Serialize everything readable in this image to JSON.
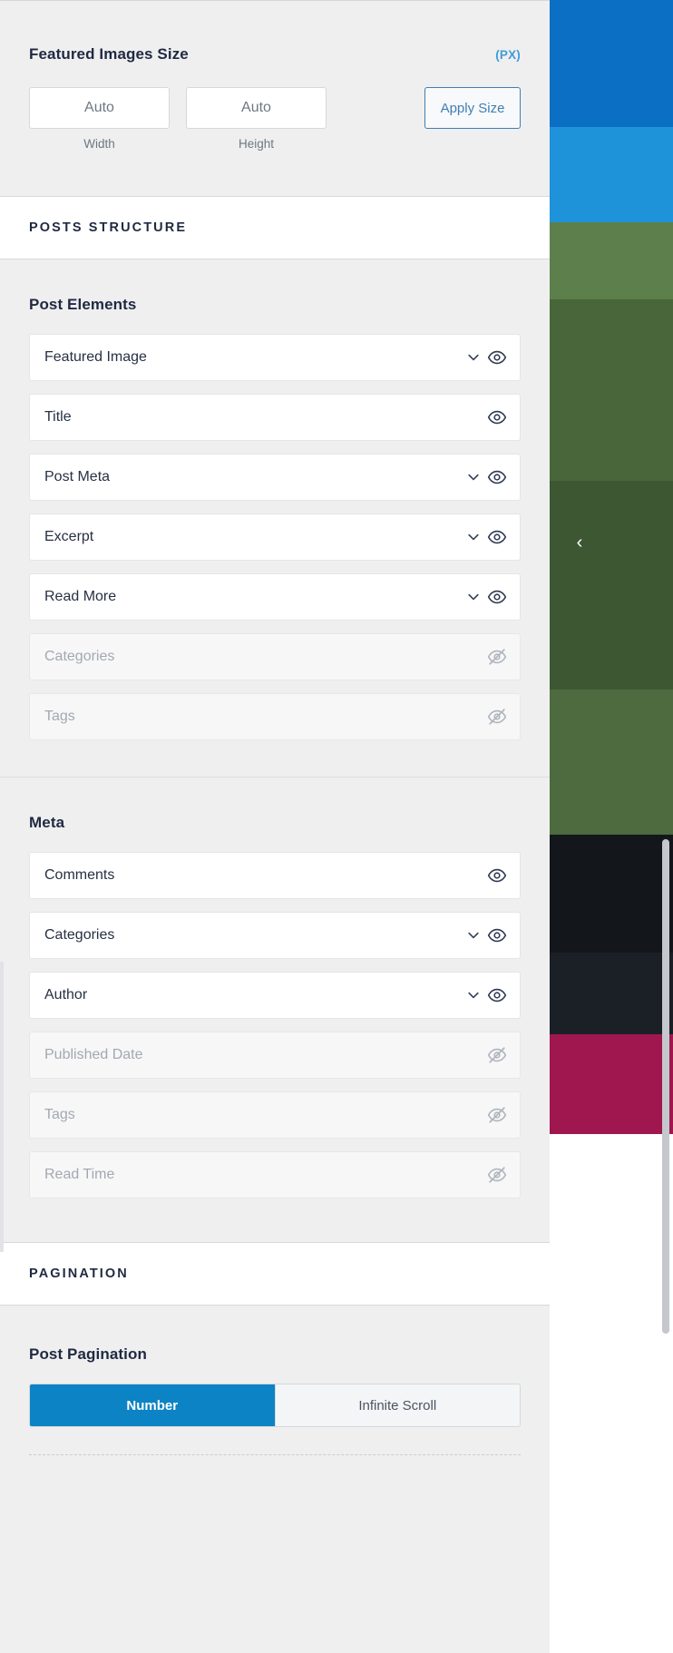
{
  "featured_images_size": {
    "title": "Featured Images Size",
    "unit_label": "(PX)",
    "width": {
      "value": "Auto",
      "caption": "Width"
    },
    "height": {
      "value": "Auto",
      "caption": "Height"
    },
    "apply_label": "Apply Size"
  },
  "posts_structure": {
    "section_label": "POSTS STRUCTURE",
    "post_elements": {
      "title": "Post Elements",
      "items": [
        {
          "label": "Featured Image",
          "enabled": true,
          "has_chevron": true
        },
        {
          "label": "Title",
          "enabled": true,
          "has_chevron": false
        },
        {
          "label": "Post Meta",
          "enabled": true,
          "has_chevron": true
        },
        {
          "label": "Excerpt",
          "enabled": true,
          "has_chevron": true
        },
        {
          "label": "Read More",
          "enabled": true,
          "has_chevron": true
        },
        {
          "label": "Categories",
          "enabled": false,
          "has_chevron": false
        },
        {
          "label": "Tags",
          "enabled": false,
          "has_chevron": false
        }
      ]
    },
    "meta": {
      "title": "Meta",
      "items": [
        {
          "label": "Comments",
          "enabled": true,
          "has_chevron": false
        },
        {
          "label": "Categories",
          "enabled": true,
          "has_chevron": true
        },
        {
          "label": "Author",
          "enabled": true,
          "has_chevron": true
        },
        {
          "label": "Published Date",
          "enabled": false,
          "has_chevron": false
        },
        {
          "label": "Tags",
          "enabled": false,
          "has_chevron": false
        },
        {
          "label": "Read Time",
          "enabled": false,
          "has_chevron": false
        }
      ]
    }
  },
  "pagination": {
    "section_label": "PAGINATION",
    "title": "Post Pagination",
    "options": [
      {
        "label": "Number",
        "active": true
      },
      {
        "label": "Infinite Scroll",
        "active": false
      }
    ]
  },
  "preview": {
    "prev_arrow": "‹"
  },
  "colors": {
    "accent_blue": "#0c83c4",
    "link_blue": "#3f7fb5",
    "unit_blue": "#3f9cd9",
    "panel_bg": "#efefef",
    "text_dark": "#273044",
    "text_muted": "#a3a8b0"
  }
}
